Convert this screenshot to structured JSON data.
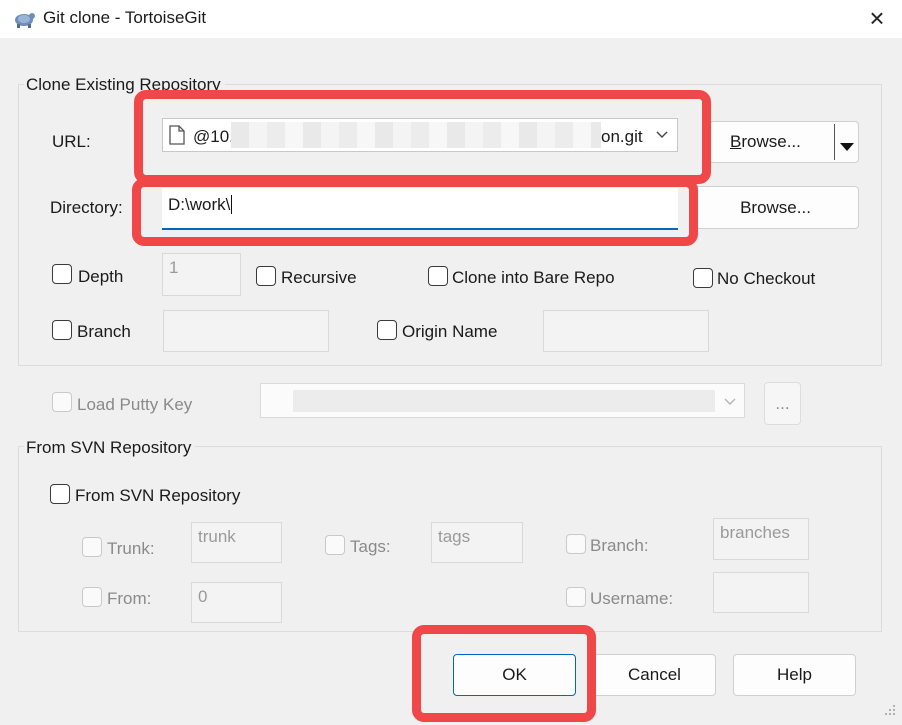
{
  "window": {
    "title": "Git clone - TortoiseGit",
    "close_icon": "×"
  },
  "clone_group": {
    "legend": "Clone Existing Repository",
    "url_label": "URL:",
    "url_value_start": "@10.",
    "url_value_end": "on.git",
    "url_browse_b": "B",
    "url_browse_rest": "rowse...",
    "directory_label": "Directory:",
    "directory_value": "D:\\work\\",
    "directory_browse": "Browse...",
    "depth_label": "Depth",
    "depth_value": "1",
    "recursive_label": "Recursive",
    "bare_label": "Clone into Bare Repo",
    "no_checkout_label": "No Checkout",
    "branch_label": "Branch",
    "origin_label": "Origin Name"
  },
  "putty": {
    "label": "Load Putty Key",
    "browse": "..."
  },
  "svn_group": {
    "legend": "From SVN Repository",
    "enable_label": "From SVN Repository",
    "trunk_label": "Trunk:",
    "trunk_value": "trunk",
    "tags_label": "Tags:",
    "tags_value": "tags",
    "branch_label": "Branch:",
    "branch_value": "branches",
    "from_label": "From:",
    "from_value": "0",
    "username_label": "Username:"
  },
  "buttons": {
    "ok": "OK",
    "cancel": "Cancel",
    "help": "Help"
  },
  "colors": {
    "highlight": "#f04848",
    "focus_underline": "#0067c0"
  }
}
